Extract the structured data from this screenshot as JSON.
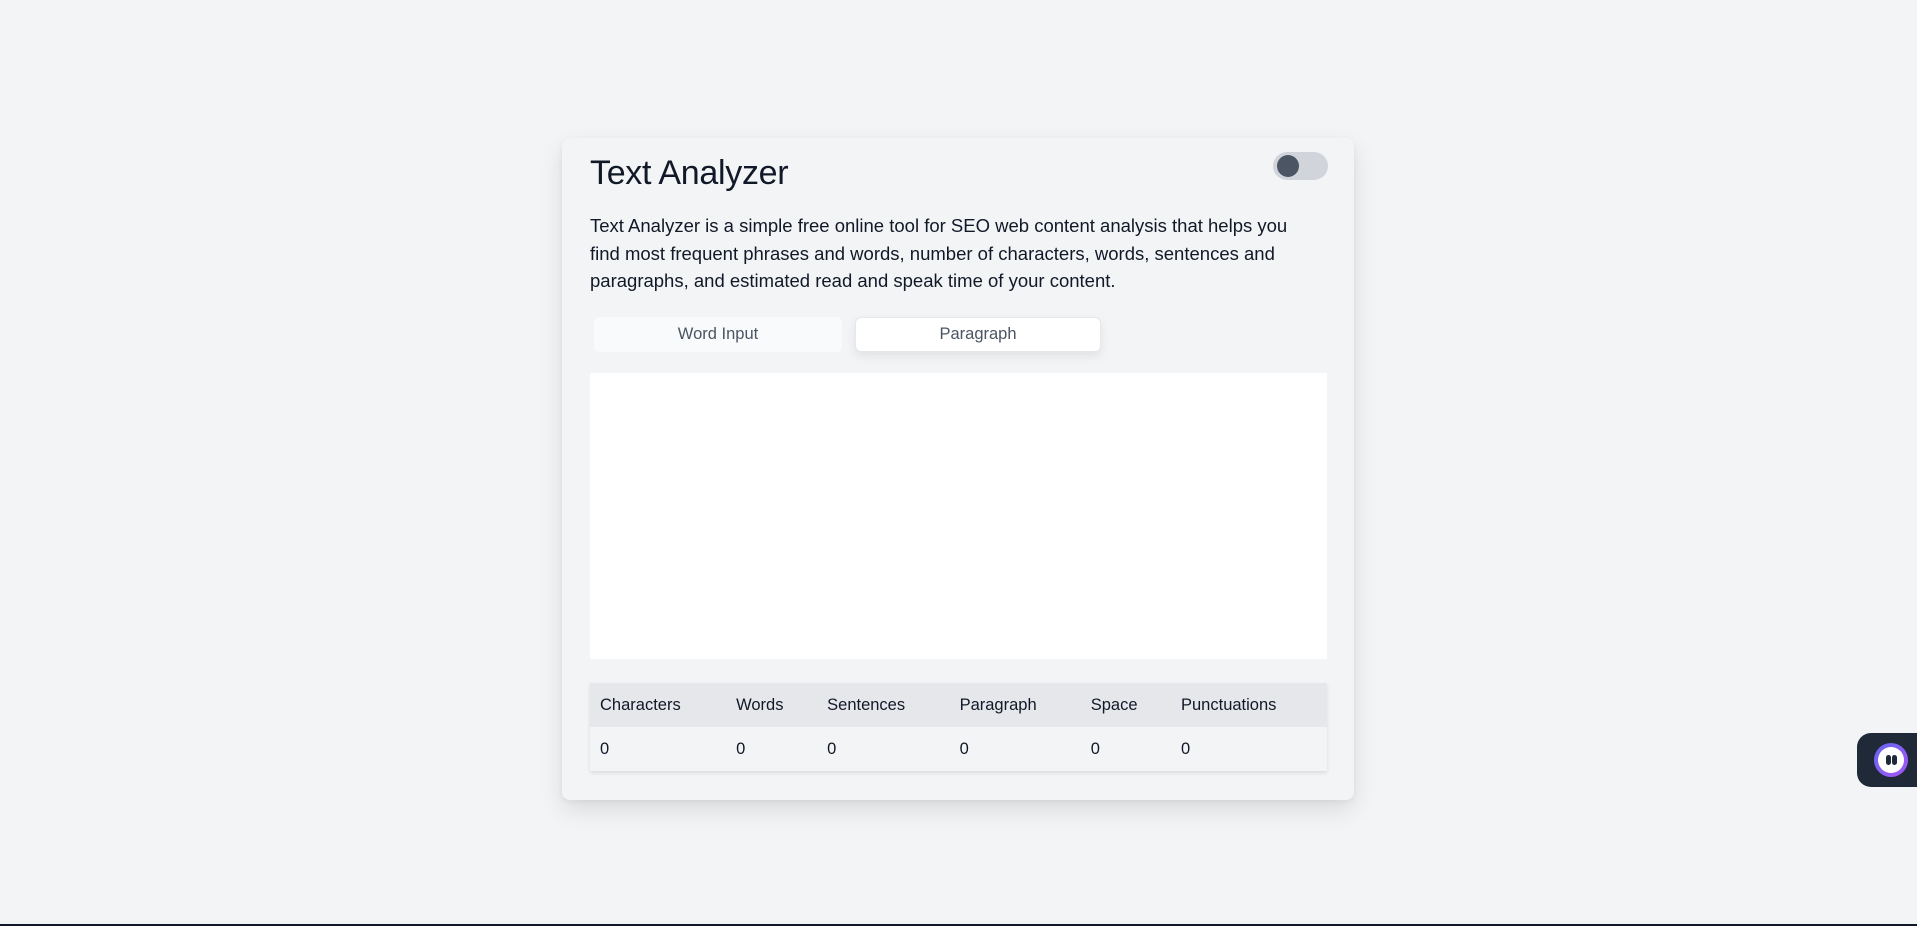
{
  "app": {
    "title": "Text Analyzer",
    "description": "Text Analyzer is a simple free online tool for SEO web content analysis that helps you find most frequent phrases and words, number of characters, words, sentences and paragraphs, and estimated read and speak time of your content."
  },
  "theme_toggle": {
    "state": "off"
  },
  "tabs": [
    {
      "label": "Word Input",
      "active": false
    },
    {
      "label": "Paragraph",
      "active": true
    }
  ],
  "editor": {
    "value": "",
    "placeholder": ""
  },
  "stats": {
    "headers": [
      "Characters",
      "Words",
      "Sentences",
      "Paragraph",
      "Space",
      "Punctuations"
    ],
    "values": [
      "0",
      "0",
      "0",
      "0",
      "0",
      "0"
    ]
  },
  "chat_widget": {
    "icon": "chat-bot-icon"
  },
  "colors": {
    "background": "#f3f4f6",
    "toggle_track": "#d1d5db",
    "toggle_knob": "#4b5563",
    "table_header": "#e5e7eb"
  }
}
